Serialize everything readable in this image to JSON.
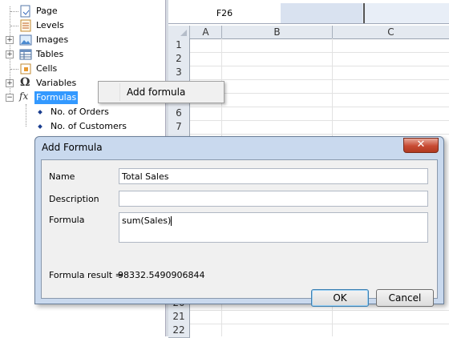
{
  "tree": {
    "items": [
      {
        "label": "Page",
        "icon": "page-icon"
      },
      {
        "label": "Levels",
        "icon": "levels-icon"
      },
      {
        "label": "Images",
        "icon": "images-icon"
      },
      {
        "label": "Tables",
        "icon": "tables-icon"
      },
      {
        "label": "Cells",
        "icon": "cells-icon"
      },
      {
        "label": "Variables",
        "icon": "omega-icon"
      },
      {
        "label": "Formulas",
        "icon": "fx-icon",
        "selected": true
      }
    ],
    "formula_children": [
      "No. of Orders",
      "No. of Customers"
    ]
  },
  "sheet": {
    "cell_ref": "F26",
    "columns": [
      "A",
      "B",
      "C"
    ],
    "rows_top": [
      "1",
      "2",
      "3",
      "",
      "6",
      "7"
    ],
    "rows_bottom": [
      "20",
      "21",
      "22"
    ]
  },
  "context_menu": {
    "item": "Add formula"
  },
  "dialog": {
    "title": "Add Formula",
    "close_glyph": "✕",
    "name_label": "Name",
    "name_value": "Total Sales",
    "description_label": "Description",
    "description_value": "",
    "formula_label": "Formula",
    "formula_value": "sum(Sales)",
    "result_label": "Formula result =",
    "result_value": "98332.5490906844",
    "ok_label": "OK",
    "cancel_label": "Cancel"
  },
  "colors": {
    "selection": "#3399ff",
    "dialog_frame": "#c9d9ee",
    "close_button": "#c74a32"
  }
}
